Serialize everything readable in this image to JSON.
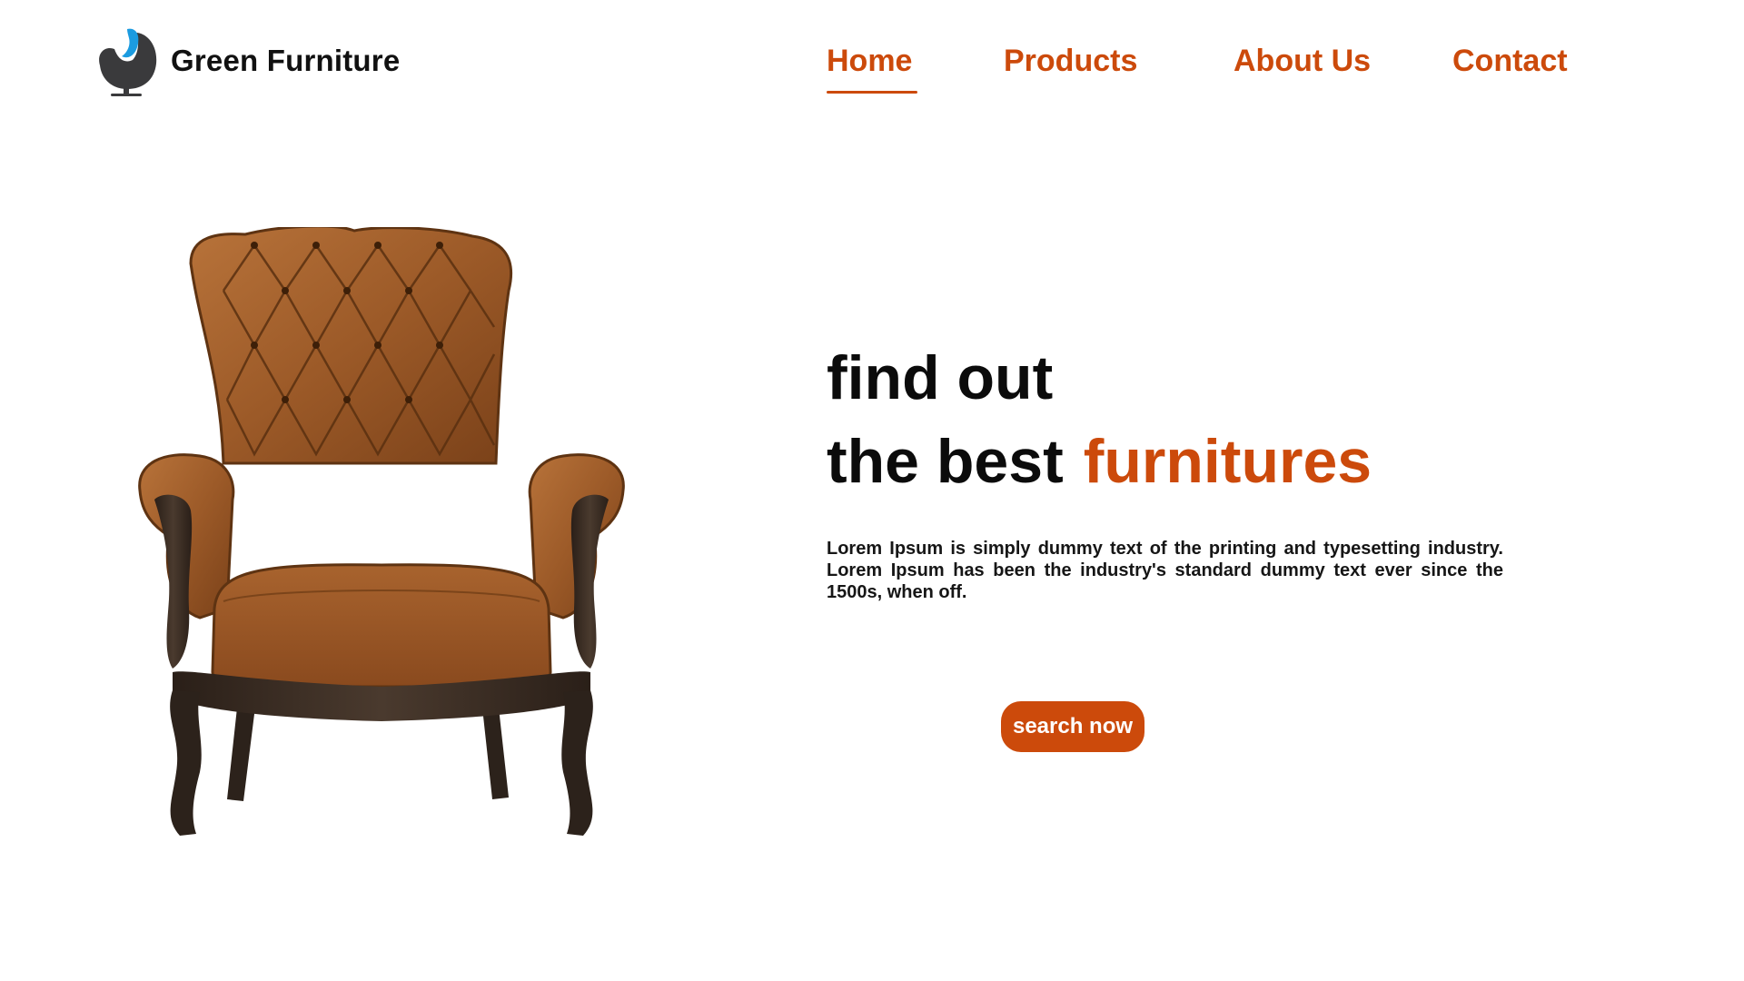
{
  "brand": {
    "name": "Green Furniture",
    "logo_icon": "egg-chair-logo-icon",
    "logo_colors": {
      "seat": "#3a3a3c",
      "accent": "#1b9be0"
    }
  },
  "nav": {
    "items": [
      {
        "label": "Home",
        "active": true
      },
      {
        "label": "Products",
        "active": false
      },
      {
        "label": "About Us",
        "active": false
      },
      {
        "label": "Contact",
        "active": false
      }
    ]
  },
  "hero": {
    "title_line1": "find out",
    "title_line2_prefix": "the best",
    "title_line2_accent": "furnitures",
    "description": "Lorem Ipsum is simply dummy text of the printing and typesetting industry. Lorem Ipsum has been the industry's standard dummy text ever since the 1500s, when off.",
    "cta_label": "search now",
    "image_icon": "leather-armchair-image"
  },
  "colors": {
    "accent": "#cc4a0b",
    "text": "#0b0b0b",
    "background": "#ffffff"
  }
}
